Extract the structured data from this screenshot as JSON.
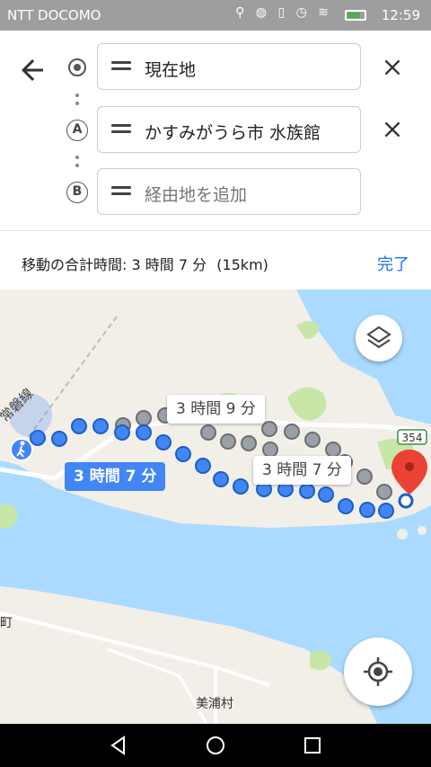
{
  "status_bar": {
    "carrier": "NTT DOCOMO",
    "time": "12:59",
    "battery_level": 0.7
  },
  "directions": {
    "origin": "現在地",
    "stop_a": "かすみがうら市 水族館",
    "stop_b_placeholder": "経由地を追加",
    "label_a": "A",
    "label_b": "B"
  },
  "summary": {
    "total_time": "移動の合計時間: 3 時間 7 分",
    "distance": "(15km)",
    "done": "完了"
  },
  "map": {
    "route_primary_label": "3 時間 7 分",
    "route_alt1_label": "3 時間 9 分",
    "route_alt2_label": "3 時間 7 分",
    "rail_line": "常磐線",
    "road_number": "354",
    "town_label": "美浦村",
    "edge_label": "町",
    "colors": {
      "route_primary": "#4285f4",
      "route_alt": "#9aa0a6",
      "water": "#aadaff",
      "land": "#f2efe9",
      "park": "#c8e6a8",
      "pin": "#ea4335"
    }
  },
  "icons": [
    "back-arrow-icon",
    "origin-target-icon",
    "drag-handle-icon",
    "close-icon",
    "layers-icon",
    "my-location-icon",
    "walking-icon",
    "destination-pin-icon",
    "nav-back-icon",
    "nav-home-icon",
    "nav-recents-icon"
  ]
}
